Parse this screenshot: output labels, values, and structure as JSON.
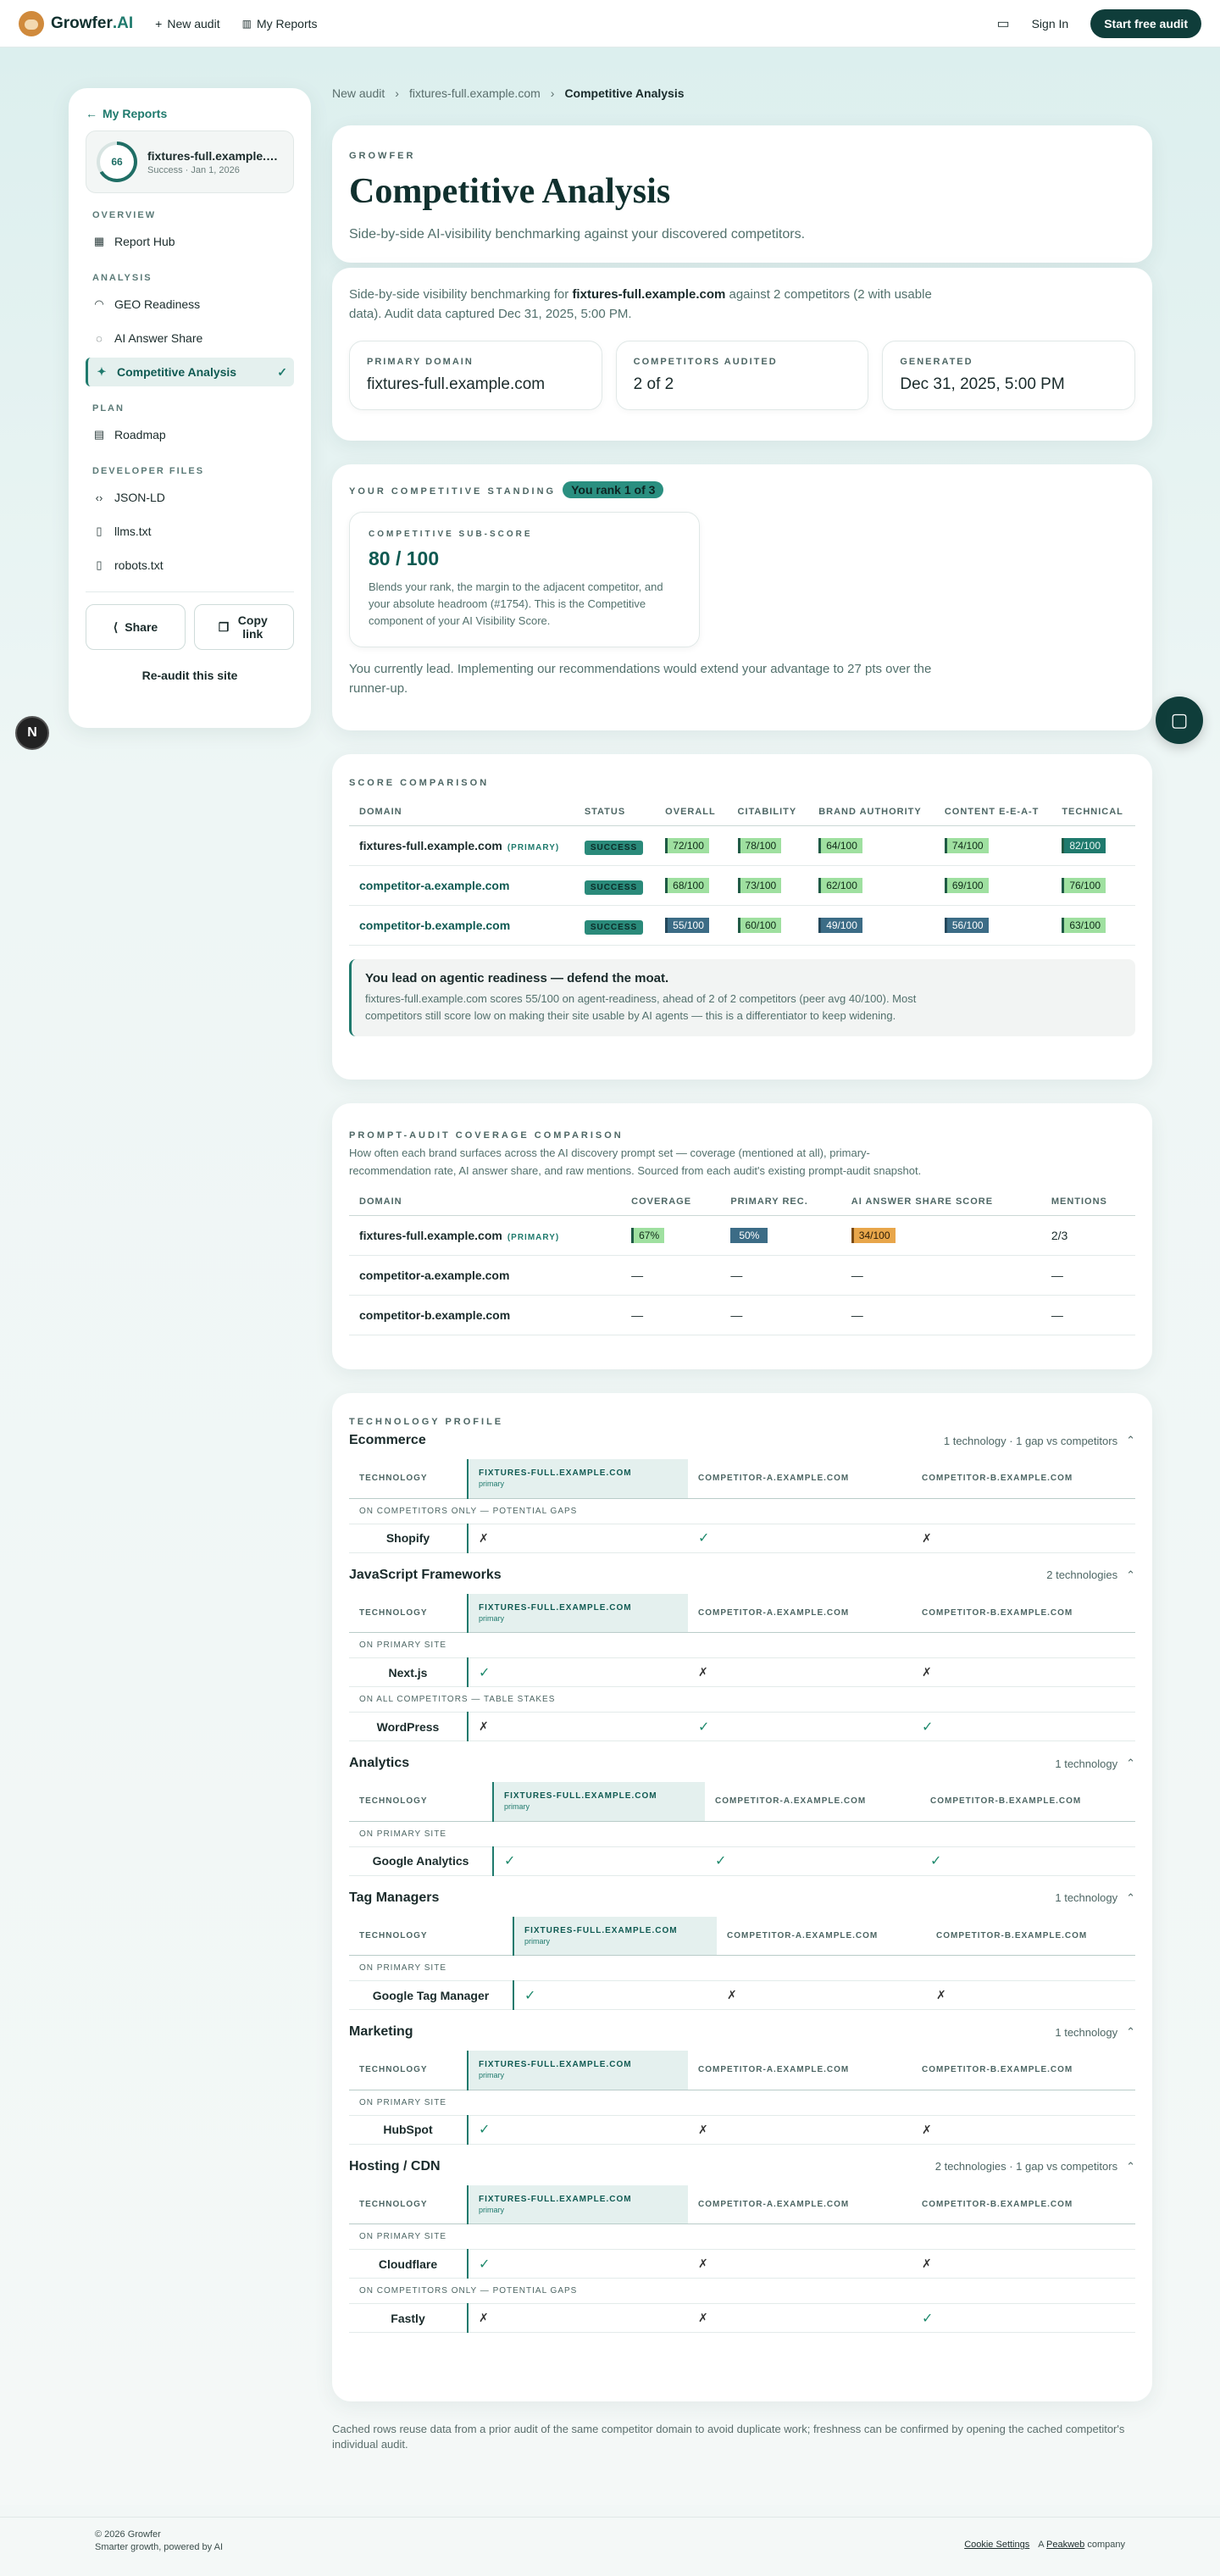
{
  "nav": {
    "brand": "Growfer",
    "brand_ai": ".AI",
    "new_audit": "New audit",
    "my_reports": "My Reports",
    "sign_in": "Sign In",
    "cta": "Start free audit"
  },
  "sidebar": {
    "back": "My Reports",
    "report_name": "fixtures-full.example.com",
    "report_meta": "Success · Jan 1, 2026",
    "score": "66",
    "sections": {
      "overview": "OVERVIEW",
      "analysis": "ANALYSIS",
      "plan": "PLAN",
      "devfiles": "DEVELOPER FILES"
    },
    "items": {
      "hub": "Report Hub",
      "geo": "GEO Readiness",
      "share": "AI Answer Share",
      "comp": "Competitive Analysis",
      "roadmap": "Roadmap",
      "jsonld": "JSON-LD",
      "llms": "llms.txt",
      "robots": "robots.txt"
    },
    "share_btn": "Share",
    "copy_btn": "Copy link",
    "reaudit": "Re-audit this site"
  },
  "crumbs": {
    "a": "New audit",
    "b": "fixtures-full.example.com",
    "c": "Competitive Analysis"
  },
  "header": {
    "eyebrow": "GROWFER",
    "title": "Competitive Analysis",
    "subtitle": "Side-by-side AI-visibility benchmarking against your discovered competitors."
  },
  "overview": {
    "p1": "Side-by-side visibility benchmarking for ",
    "domain": "fixtures-full.example.com",
    "p2": " against 2 competitors (2 with usable data). Audit data captured Dec 31, 2025, 5:00 PM.",
    "stats": [
      {
        "label": "PRIMARY DOMAIN",
        "value": "fixtures-full.example.com"
      },
      {
        "label": "COMPETITORS AUDITED",
        "value": "2 of 2"
      },
      {
        "label": "GENERATED",
        "value": "Dec 31, 2025, 5:00 PM"
      }
    ]
  },
  "standing": {
    "label": "YOUR COMPETITIVE STANDING",
    "rank": "You rank 1 of 3",
    "sub_label": "COMPETITIVE SUB-SCORE",
    "sub_value": "80 / 100",
    "sub_desc": "Blends your rank, the margin to the adjacent competitor, and your absolute headroom (#1754). This is the Competitive component of your AI Visibility Score.",
    "lead": "You currently lead. Implementing our recommendations would extend your advantage to 27 pts over the runner-up."
  },
  "scores": {
    "label": "SCORE COMPARISON",
    "headers": [
      "DOMAIN",
      "STATUS",
      "OVERALL",
      "CITABILITY",
      "BRAND AUTHORITY",
      "CONTENT E-E-A-T",
      "TECHNICAL"
    ],
    "primary_tag": "(PRIMARY)",
    "rows": [
      {
        "domain": "fixtures-full.example.com",
        "status": "SUCCESS",
        "v": [
          "72/100",
          "78/100",
          "64/100",
          "74/100",
          "82/100"
        ]
      },
      {
        "domain": "competitor-a.example.com",
        "status": "SUCCESS",
        "v": [
          "68/100",
          "73/100",
          "62/100",
          "69/100",
          "76/100"
        ]
      },
      {
        "domain": "competitor-b.example.com",
        "status": "SUCCESS",
        "v": [
          "55/100",
          "60/100",
          "49/100",
          "56/100",
          "63/100"
        ]
      }
    ],
    "callout_title": "You lead on agentic readiness — defend the moat.",
    "callout_desc": "fixtures-full.example.com scores 55/100 on agent-readiness, ahead of 2 of 2 competitors (peer avg 40/100). Most competitors still score low on making their site usable by AI agents — this is a differentiator to keep widening."
  },
  "prompt": {
    "label": "PROMPT-AUDIT COVERAGE COMPARISON",
    "desc": "How often each brand surfaces across the AI discovery prompt set — coverage (mentioned at all), primary-recommendation rate, AI answer share, and raw mentions. Sourced from each audit's existing prompt-audit snapshot.",
    "headers": [
      "DOMAIN",
      "COVERAGE",
      "PRIMARY REC.",
      "AI ANSWER SHARE SCORE",
      "MENTIONS"
    ],
    "rows": [
      {
        "domain": "fixtures-full.example.com",
        "v": [
          "67%",
          "50%",
          "34/100",
          "2/3"
        ]
      },
      {
        "domain": "competitor-a.example.com",
        "v": [
          "—",
          "—",
          "—",
          "—"
        ]
      },
      {
        "domain": "competitor-b.example.com",
        "v": [
          "—",
          "—",
          "—",
          "—"
        ]
      }
    ]
  },
  "tech": {
    "label": "TECHNOLOGY PROFILE",
    "col_tech": "TECHNOLOGY",
    "col_p": "FIXTURES-FULL.EXAMPLE.COM",
    "col_p_sub": "primary",
    "col_a": "COMPETITOR-A.EXAMPLE.COM",
    "col_b": "COMPETITOR-B.EXAMPLE.COM",
    "groups": [
      {
        "name": "Ecommerce",
        "meta": "1 technology · 1 gap vs competitors"
      },
      {
        "name": "JavaScript Frameworks",
        "meta": "2 technologies"
      },
      {
        "name": "Analytics",
        "meta": "1 technology"
      },
      {
        "name": "Tag Managers",
        "meta": "1 technology"
      },
      {
        "name": "Marketing",
        "meta": "1 technology"
      },
      {
        "name": "Hosting / CDN",
        "meta": "2 technologies · 1 gap vs competitors"
      }
    ],
    "sub_gap": "ON COMPETITORS ONLY — POTENTIAL GAPS",
    "sub_primary": "ON PRIMARY SITE",
    "sub_all": "ON ALL COMPETITORS — TABLE STAKES",
    "techs": {
      "shopify": "Shopify",
      "next": "Next.js",
      "wp": "WordPress",
      "ga": "Google Analytics",
      "gtm": "Google Tag Manager",
      "hubspot": "HubSpot",
      "cloudflare": "Cloudflare",
      "fastly": "Fastly"
    }
  },
  "footnote": "Cached rows reuse data from a prior audit of the same competitor domain to avoid duplicate work; freshness can be confirmed by opening the cached competitor's individual audit.",
  "footer": {
    "copy": "© 2026 Growfer",
    "tag": "Smarter growth, powered by AI",
    "cookie": "Cookie Settings",
    "company_a": "A",
    "company_link": "Peakweb",
    "company_b": "company"
  },
  "colors": {
    "accent": "#1f7a6d",
    "dark": "#0f3d3a"
  }
}
